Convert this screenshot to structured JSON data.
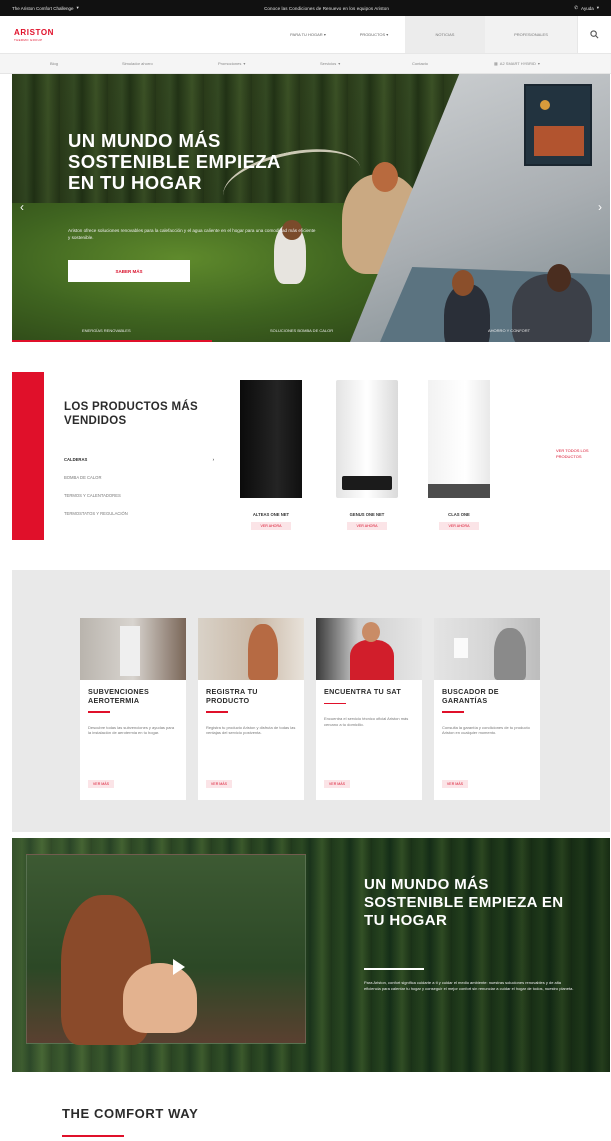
{
  "topbar": {
    "left_label": "The Ariston Comfort Challenge",
    "message": "Conoce las Condiciones de Renuevo en los equipos Ariston",
    "right_label": "Ayuda"
  },
  "header": {
    "brand": "ARISTON",
    "tagline": "THERMO GROUP",
    "nav": [
      "Para tu Hogar",
      "Productos",
      "Noticias",
      "Profesionales"
    ]
  },
  "subnav": {
    "items": [
      "Blog",
      "Simulador ahorro",
      "Promociones",
      "Servicios",
      "Contacto",
      "A2 SMART HYBRID"
    ]
  },
  "hero": {
    "title": "UN MUNDO MÁS SOSTENIBLE EMPIEZA EN TU HOGAR",
    "lead": "Ariston ofrece soluciones renovables para la calefacción y el agua caliente en el hogar para una comodidad más eficiente y sostenible.",
    "cta": "Saber más",
    "slides": [
      "Energías renovables",
      "Soluciones bomba de calor",
      "Ahorro y confort"
    ]
  },
  "bestsellers": {
    "title": "LOS PRODUCTOS MÁS VENDIDOS",
    "categories": [
      "Calderas",
      "Bomba de calor",
      "Termos y calentadores",
      "Termostatos y regulación"
    ],
    "products": [
      {
        "name": "ALTEAS ONE NET",
        "link": "Ver ahora"
      },
      {
        "name": "GENUS ONE NET",
        "link": "Ver ahora"
      },
      {
        "name": "CLAS ONE",
        "link": "Ver ahora"
      }
    ],
    "all_products": "Ver todos los productos"
  },
  "services": [
    {
      "title": "SUBVENCIONES AEROTERMIA",
      "desc": "Descubre todas las subvenciones y ayudas para la instalación de aerotermia en tu hogar.",
      "more": "Ver más"
    },
    {
      "title": "REGISTRA TU PRODUCTO",
      "desc": "Registra tu producto Ariston y disfruta de todas las ventajas del servicio postventa.",
      "more": "Ver más"
    },
    {
      "title": "ENCUENTRA TU SAT",
      "desc": "Encuentra el servicio técnico oficial Ariston más cercano a tu domicilio.",
      "more": "Ver más"
    },
    {
      "title": "BUSCADOR DE GARANTÍAS",
      "desc": "Consulta la garantía y condiciones de tu producto Ariston en cualquier momento.",
      "more": "Ver más"
    }
  ],
  "video": {
    "title": "UN MUNDO MÁS SOSTENIBLE EMPIEZA EN TU HOGAR",
    "desc": "Para Ariston, confort significa cuidarte a ti y cuidar el medio ambiente: nuestras soluciones renovables y de alta eficiencia para calentar tu hogar y conseguir el mejor confort sin renunciar a cuidar el hogar de todos, nuestro planeta."
  },
  "comfort": {
    "title": "THE COMFORT WAY"
  }
}
